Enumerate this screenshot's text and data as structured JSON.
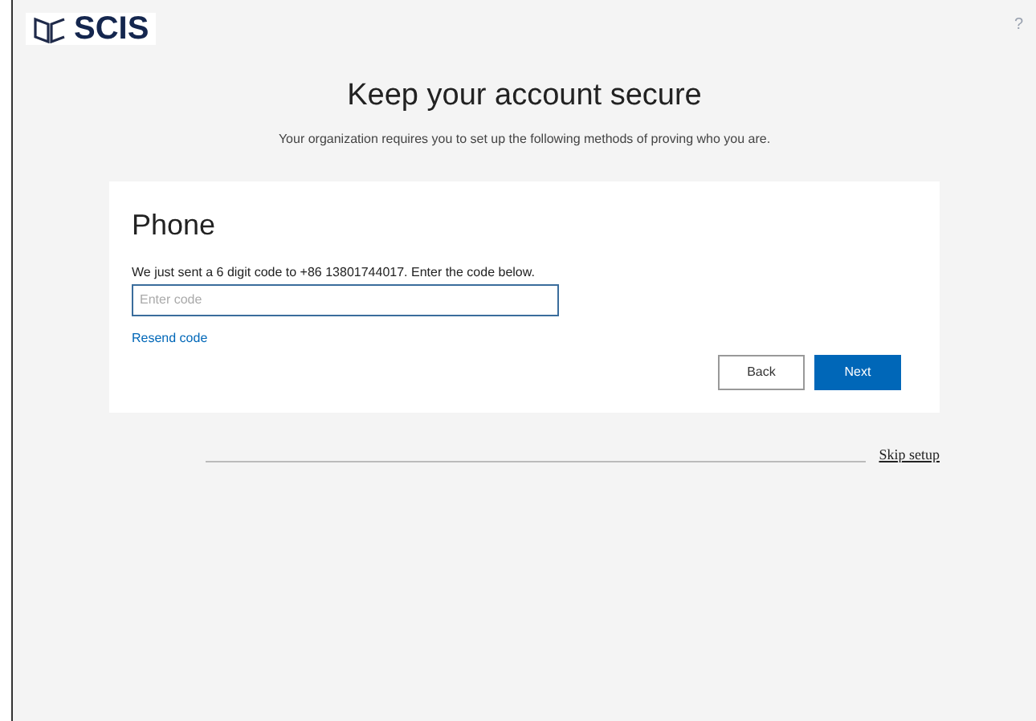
{
  "logo": {
    "text": "SCIS"
  },
  "help": "?",
  "title": "Keep your account secure",
  "subtitle": "Your organization requires you to set up the following methods of proving who you are.",
  "card": {
    "heading": "Phone",
    "instruction": "We just sent a 6 digit code to +86 13801744017. Enter the code below.",
    "code_field": {
      "placeholder": "Enter code"
    },
    "resend_link": "Resend code",
    "buttons": [
      {
        "label": "Back",
        "kind": "secondary"
      },
      {
        "label": "Next",
        "kind": "primary"
      }
    ]
  },
  "skip_link": "Skip setup"
}
